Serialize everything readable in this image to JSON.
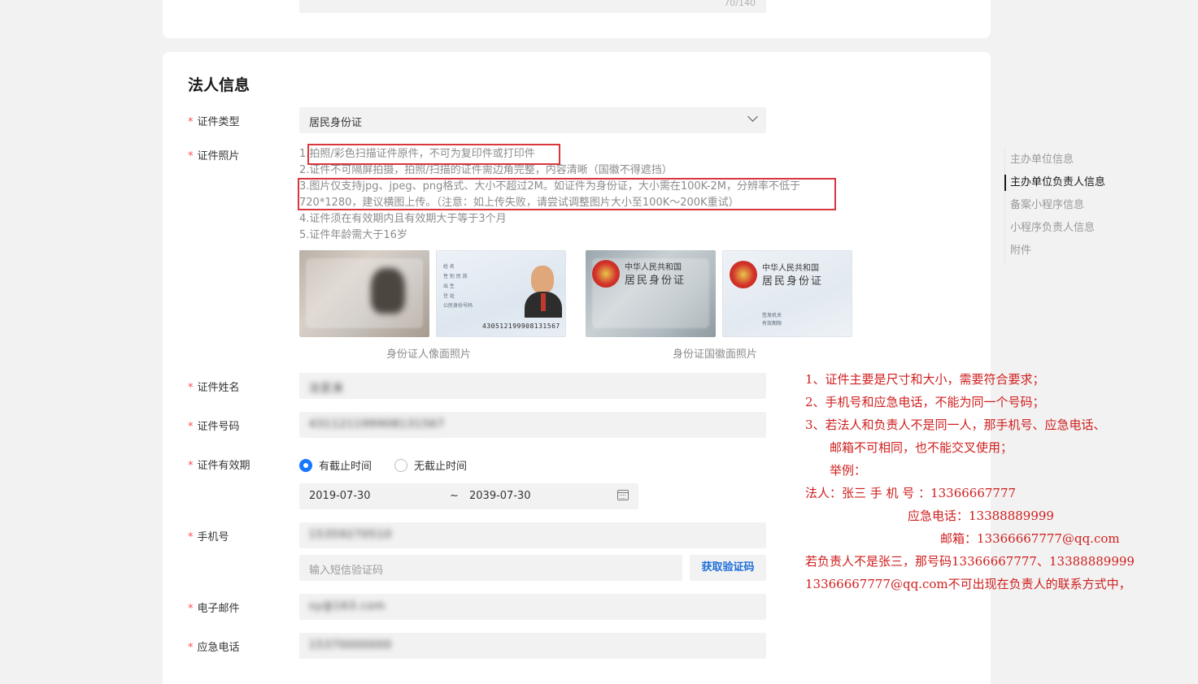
{
  "top_card": {
    "counter": "70/140"
  },
  "section": {
    "title": "法人信息"
  },
  "required_mark": "*",
  "fields": {
    "id_type": {
      "label": "证件类型",
      "value": "居民身份证"
    },
    "id_photo": {
      "label": "证件照片"
    },
    "id_name": {
      "label": "证件姓名",
      "value": "沈亚涛"
    },
    "id_number": {
      "label": "证件号码",
      "value": "431121199908131567"
    },
    "id_validity": {
      "label": "证件有效期",
      "option_has_expiry": "有截止时间",
      "option_no_expiry": "无截止时间",
      "selected": "有截止时间",
      "start_date": "2019-07-30",
      "separator": "~",
      "end_date": "2039-07-30"
    },
    "phone": {
      "label": "手机号",
      "value": "15359270510",
      "sms_placeholder": "输入短信验证码",
      "sms_button": "获取验证码"
    },
    "email": {
      "label": "电子邮件",
      "value": "sy@163.com"
    },
    "emergency_phone": {
      "label": "应急电话",
      "value": "15370000000"
    }
  },
  "tips": [
    "1.拍照/彩色扫描证件原件，不可为复印件或打印件",
    "2.证件不可隔屏拍摄，拍照/扫描的证件需边角完整，内容清晰（国徽不得遮挡）",
    "3.图片仅支持jpg、jpeg、png格式、大小不超过2M。如证件为身份证，大小需在100K-2M，分辨率不低于",
    "720*1280，建议横图上传。（注意：如上传失败，请尝试调整图片大小至100K～200K重试）",
    "4.证件须在有效期内且有效期大于等于3个月",
    "5.证件年龄需大于16岁"
  ],
  "id_card_samples": {
    "front_caption": "身份证人像面照片",
    "back_caption": "身份证国徽面照片",
    "sample_number": "430512199908131567",
    "front_lines": [
      "姓 名",
      "性 别  民 族",
      "出 生",
      "住 址",
      "公民身份号码"
    ],
    "back_title_small": "中华人民共和国",
    "back_title_big": "居民身份证",
    "back_lines": [
      "签发机关",
      "有效期限"
    ]
  },
  "side_nav": [
    {
      "label": "主办单位信息",
      "active": false
    },
    {
      "label": "主办单位负责人信息",
      "active": true
    },
    {
      "label": "备案小程序信息",
      "active": false
    },
    {
      "label": "小程序负责人信息",
      "active": false
    },
    {
      "label": "附件",
      "active": false
    }
  ],
  "annotation": [
    "1、证件主要是尺寸和大小，需要符合要求；",
    "2、手机号和应急电话，不能为同一个号码；",
    "3、若法人和负责人不是同一人，那手机号、应急电话、",
    "   邮箱不可相同，也不能交叉使用；",
    "",
    "   举例：",
    "法人：张三    手 机 号 ：13366667777",
    "             应急电话：13388889999",
    "                 邮箱：13366667777@qq.com",
    "若负责人不是张三，那号码13366667777、13388889999",
    "13366667777@qq.com不可出现在负责人的联系方式中，"
  ],
  "colors": {
    "required": "#fa5151",
    "primary": "#1677ff",
    "link": "#1e6fd9",
    "annotation": "#d01e1e",
    "highlight_box": "#d9363e"
  }
}
